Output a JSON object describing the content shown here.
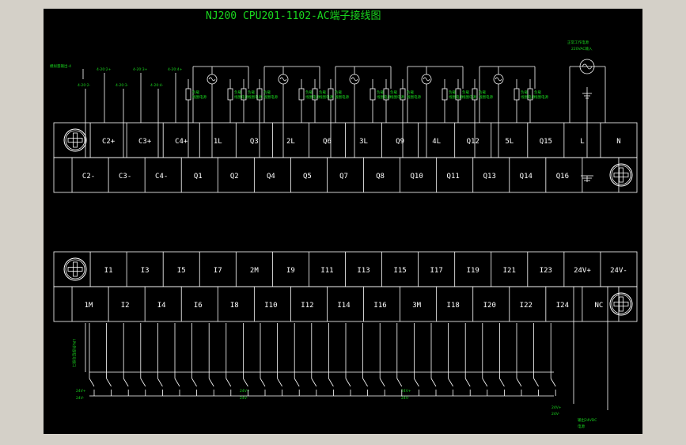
{
  "title": "NJ200 CPU201-1102-AC端子接线图",
  "power_supply": {
    "line1": "正常工作电源",
    "line2": "220VAC输入"
  },
  "green_note_left": "模拟量输出-4",
  "analog_labels": [
    "4-20:2+",
    "4-20:2-",
    "4-20:3+",
    "4-20:3-",
    "4-20:4+",
    "4-20:4-"
  ],
  "load_label": "负载",
  "coil_label": "线圈电源",
  "output_terminals": {
    "top": [
      "",
      "C2+",
      "C3+",
      "C4+",
      "1L",
      "Q3",
      "2L",
      "Q6",
      "3L",
      "Q9",
      "4L",
      "Q12",
      "5L",
      "Q15",
      "L",
      "N"
    ],
    "bottom": [
      "C2-",
      "C3-",
      "C4-",
      "Q1",
      "Q2",
      "Q4",
      "Q5",
      "Q7",
      "Q8",
      "Q10",
      "Q11",
      "Q13",
      "Q14",
      "Q16",
      "",
      ""
    ]
  },
  "input_terminals": {
    "top": [
      "",
      "I1",
      "I3",
      "I5",
      "I7",
      "2M",
      "I9",
      "I11",
      "I13",
      "I15",
      "I17",
      "I19",
      "I21",
      "I23",
      "24V+",
      "24V-"
    ],
    "bottom": [
      "1M",
      "I2",
      "I4",
      "I6",
      "I8",
      "I10",
      "I12",
      "I14",
      "I16",
      "3M",
      "I18",
      "I20",
      "I22",
      "I24",
      "NC",
      ""
    ]
  },
  "input_notes": {
    "left_vertical": "LPU外部信号接口",
    "common": [
      "24V+",
      "24V-"
    ],
    "dc_out_top": "24V+",
    "dc_out_bottom": "24V-",
    "output_note": [
      "输出24VDC",
      "电源"
    ]
  },
  "colors": {
    "background": "#000000",
    "frame": "#d4d0c8",
    "lines": "#ffffff",
    "annotation": "#19d61e"
  },
  "icons": [
    "screw-terminal-icon",
    "ac-source-icon",
    "ground-icon",
    "fuse-icon",
    "switch-icon"
  ]
}
